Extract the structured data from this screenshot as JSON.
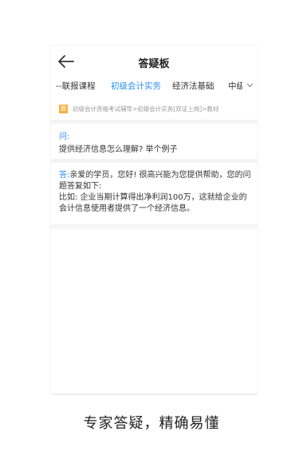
{
  "header": {
    "title": "答疑板",
    "back_icon": "back-arrow-icon"
  },
  "tabs": [
    {
      "label": "--联报课程",
      "active": false
    },
    {
      "label": "初级会计实务",
      "active": true
    },
    {
      "label": "经济法基础",
      "active": false
    },
    {
      "label": "中级",
      "active": false
    }
  ],
  "tabs_more_icon": "chevron-down-icon",
  "breadcrumb": {
    "badge": "题",
    "text": "初级会计资格考试辅导>初级会计实务[双证上岗]>教材"
  },
  "question": {
    "label": "问:",
    "text": "提供经济信息怎么理解? 举个例子"
  },
  "answer": {
    "label": "答:",
    "line1": "亲爱的学员，您好! 很高兴能为您提供帮助，您的问题答复如下:",
    "line2": "比如: 企业当期计算得出净利润100万，这就给企业的会计信息使用者提供了一个经济信息。"
  },
  "caption": "专家答疑，精确易懂",
  "colors": {
    "accent": "#2b8ff0",
    "badge": "#f3b13d"
  }
}
